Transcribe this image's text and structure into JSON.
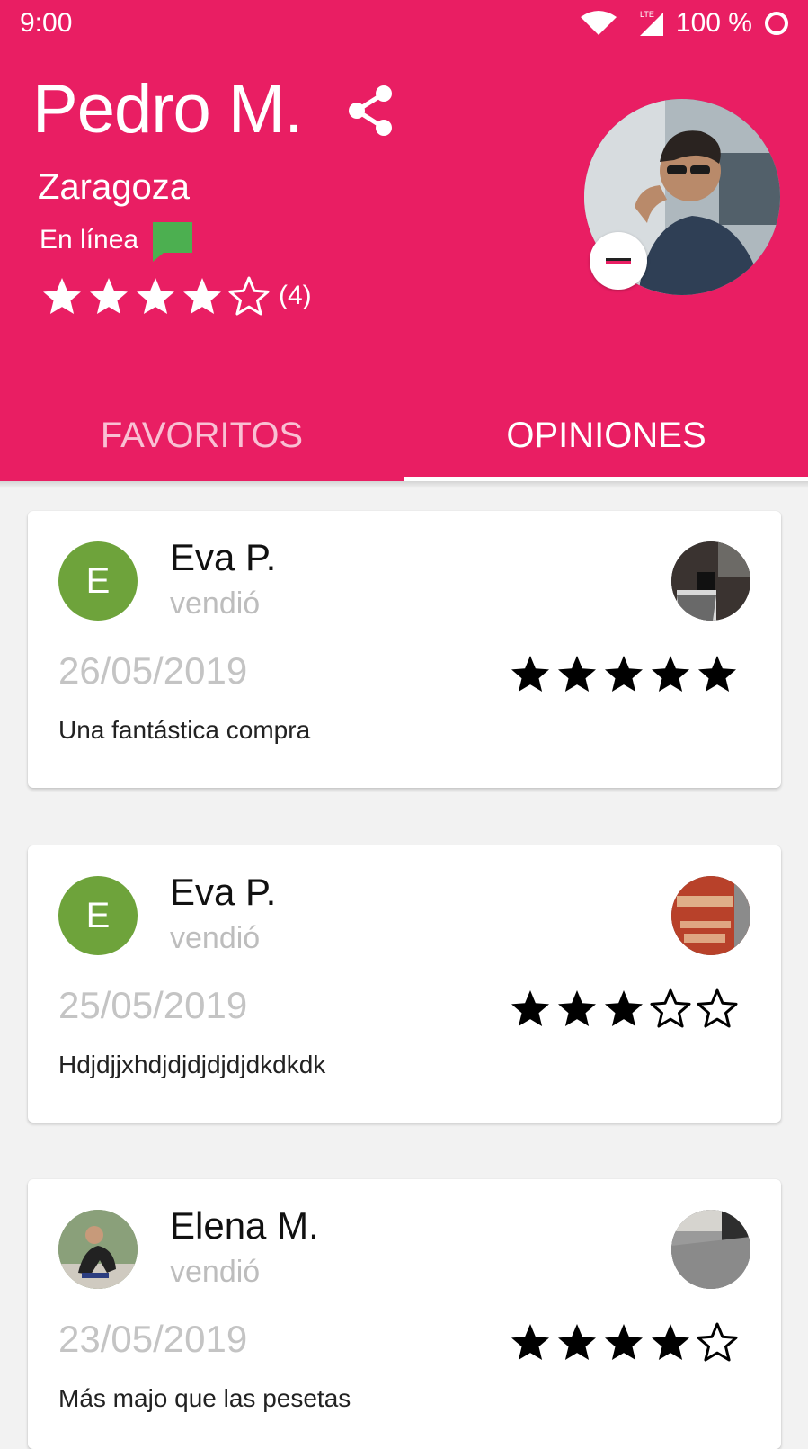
{
  "status_bar": {
    "time": "9:00",
    "network": "LTE",
    "battery": "100 %"
  },
  "profile": {
    "name": "Pedro M.",
    "city": "Zaragoza",
    "online_status": "En línea",
    "rating": 4,
    "rating_max": 5,
    "rating_count": "(4)"
  },
  "tabs": [
    {
      "label": "FAVORITOS",
      "selected": false
    },
    {
      "label": "OPINIONES",
      "selected": true
    }
  ],
  "reviews": [
    {
      "avatar_letter": "E",
      "name": "Eva P.",
      "action": "vendió",
      "date": "26/05/2019",
      "rating": 5,
      "text": "Una fantástica compra"
    },
    {
      "avatar_letter": "E",
      "name": "Eva P.",
      "action": "vendió",
      "date": "25/05/2019",
      "rating": 3,
      "text": "Hdjdjjxhdjdjdjdjdjdkdkdk"
    },
    {
      "avatar_letter": "",
      "name": "Elena M.",
      "action": "vendió",
      "date": "23/05/2019",
      "rating": 4,
      "text": "Más majo que las pesetas"
    }
  ],
  "colors": {
    "header": "#e91e63",
    "avatar_letter_bg": "#6ea33b",
    "online_icon": "#4caf50"
  },
  "icons": {
    "share": "share-icon",
    "chat": "chat-bubble-icon",
    "remove": "remove-circle-icon",
    "star_filled": "star-icon",
    "star_empty": "star-outline-icon"
  }
}
